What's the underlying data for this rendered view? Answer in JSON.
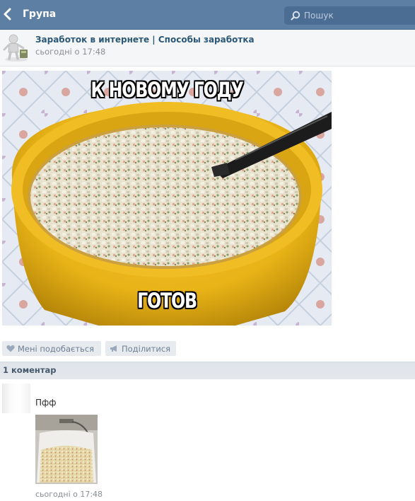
{
  "header": {
    "back_label": "Група",
    "search_placeholder": "Пошук"
  },
  "post": {
    "group_name": "Заработок в интернете | Способы заработка",
    "time": "сьогодні о 17:48",
    "meme": {
      "caption_top": "К НОВОМУ ГОДУ",
      "caption_bottom": "ГОТОВ"
    }
  },
  "actions": {
    "like_label": "Мені подобається",
    "share_label": "Поділитися"
  },
  "comments": {
    "count_label": "1 коментар",
    "items": [
      {
        "text": "Пфф",
        "time": "сьогодні о 17:48"
      }
    ]
  },
  "colors": {
    "header_bg": "#5d7fa4",
    "link": "#2b587a",
    "bowl_yellow": "#e8b317"
  }
}
